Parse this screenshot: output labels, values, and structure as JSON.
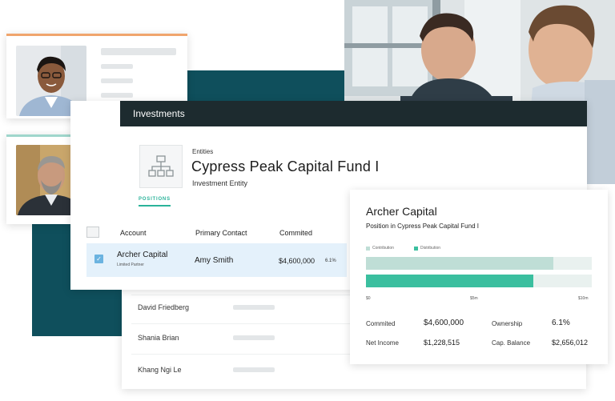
{
  "investments": {
    "header_title": "Investments",
    "entities_label": "Entities",
    "fund_name": "Cypress Peak Capital Fund I",
    "entity_type": "Investment Entity",
    "tab_positions": "POSITIONS",
    "columns": [
      "Account",
      "Primary Contact",
      "Commited"
    ],
    "selected_row": {
      "account": "Archer Capital",
      "account_sub": "Limited Partner",
      "contact": "Amy Smith",
      "commited": "$4,600,000",
      "pct": "6.1%"
    },
    "other_rows": [
      "David Friedberg",
      "Shania Brian",
      "Khang Ngi Le"
    ]
  },
  "archer": {
    "title": "Archer Capital",
    "subtitle": "Position in Cypress Peak Capital Fund I",
    "legend": [
      {
        "label": "Contribution",
        "color": "#bfded6"
      },
      {
        "label": "Distribution",
        "color": "#3bbf9f"
      }
    ],
    "axis_ticks": [
      "$0",
      "$5m",
      "$10m"
    ],
    "bars": [
      {
        "name": "Contribution",
        "fraction": 0.83,
        "color": "#bfded6"
      },
      {
        "name": "Distribution",
        "fraction": 0.74,
        "color": "#3bbf9f"
      }
    ],
    "stats": {
      "commited_label": "Commited",
      "commited_value": "$4,600,000",
      "ownership_label": "Ownership",
      "ownership_value": "6.1%",
      "net_income_label": "Net Income",
      "net_income_value": "$1,228,515",
      "cap_balance_label": "Cap. Balance",
      "cap_balance_value": "$2,656,012"
    }
  },
  "colors": {
    "teal_block": "#0f4f5c",
    "header_dark": "#1d2b2f",
    "accent_green": "#2bb39a",
    "selected_row": "#e4f1fb"
  }
}
